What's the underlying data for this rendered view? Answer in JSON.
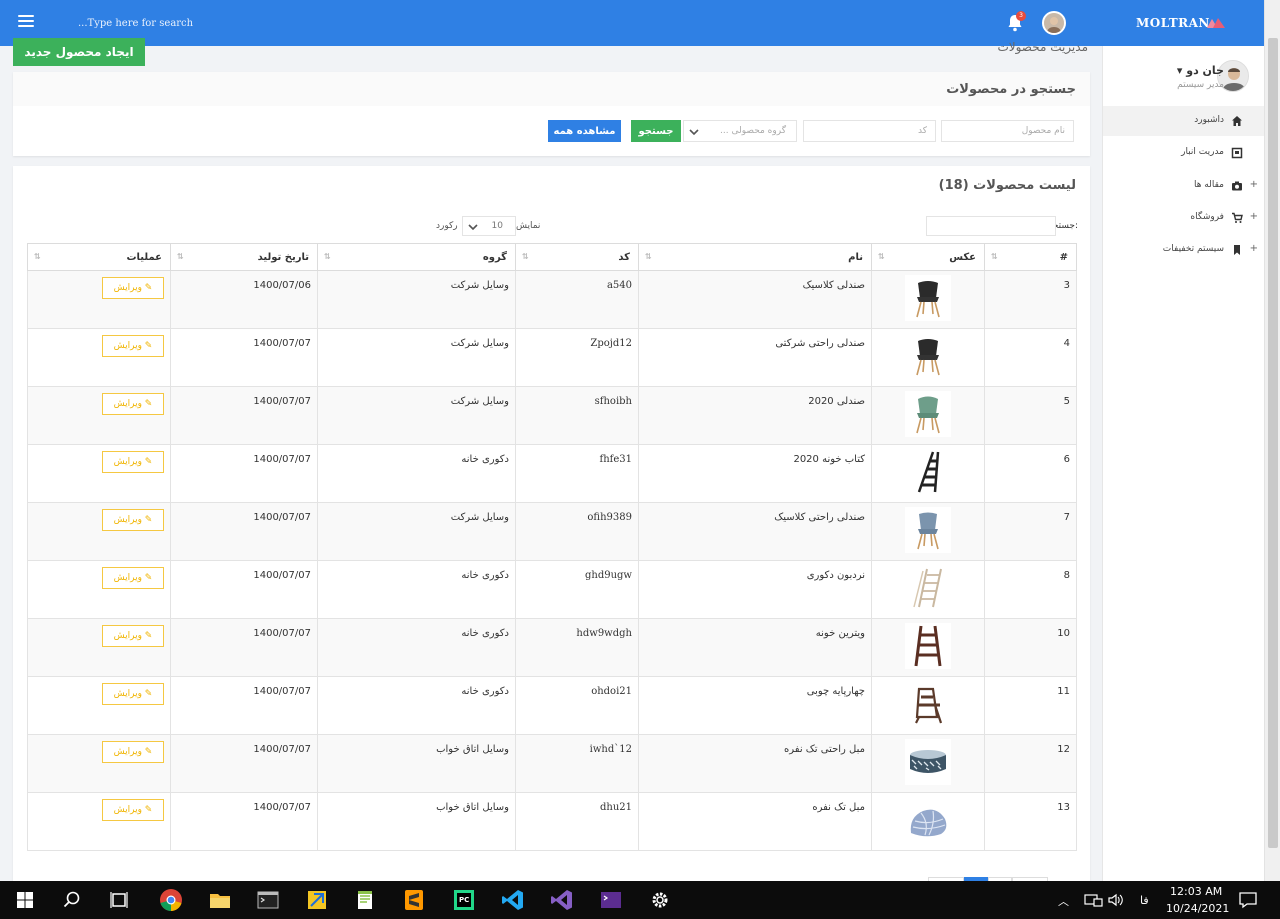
{
  "topbar": {
    "search_placeholder": "...Type here for search",
    "notification_count": "3",
    "brand": "MOLTRAN",
    "brand_color": "#2f80e4"
  },
  "sidebar": {
    "user_name": "جان دو ▾",
    "user_role": "مدیر سیستم",
    "items": [
      {
        "label": "داشبورد",
        "icon": "home-icon",
        "active": true,
        "expandable": false
      },
      {
        "label": "مدریت انبار",
        "icon": "warehouse-icon",
        "active": false,
        "expandable": false
      },
      {
        "label": "مقاله ها",
        "icon": "camera-icon",
        "active": false,
        "expandable": true
      },
      {
        "label": "فروشگاه",
        "icon": "cart-icon",
        "active": false,
        "expandable": true
      },
      {
        "label": "سیستم تخفیفات",
        "icon": "bookmark-icon",
        "active": false,
        "expandable": true
      }
    ]
  },
  "main": {
    "create_button": "ایجاد محصول جدید",
    "page_title": "مدیریت محصولات"
  },
  "search_panel": {
    "title": "جستجو در محصولات",
    "name_placeholder": "نام محصول",
    "code_placeholder": "کد",
    "group_placeholder": "گروه محصولی ...",
    "search_button": "جستجو",
    "show_all_button": "مشاهده همه",
    "search_button_color": "#3cb15b",
    "show_all_button_color": "#2f80e4"
  },
  "list": {
    "title": "لیست محصولات (18)",
    "search_label": "جستجو:",
    "length_prefix": "نمایش",
    "length_value": "10",
    "length_suffix": "رکورد",
    "columns": [
      "#",
      "عکس",
      "نام",
      "کد",
      "گروه",
      "تاریخ تولید",
      "عملیات"
    ],
    "edit_label": "✎ ویرایش",
    "rows": [
      {
        "id": "3",
        "name": "صندلی کلاسیک",
        "code": "a540",
        "group": "وسایل شرکت",
        "date": "1400/07/06",
        "image": "chair-dark-icon"
      },
      {
        "id": "4",
        "name": "صندلی راحتی شرکتی",
        "code": "Zpojd12",
        "group": "وسایل شرکت",
        "date": "1400/07/07",
        "image": "chair-dark-icon"
      },
      {
        "id": "5",
        "name": "صندلی 2020",
        "code": "sfhoibh",
        "group": "وسایل شرکت",
        "date": "1400/07/07",
        "image": "chair-green-icon"
      },
      {
        "id": "6",
        "name": "کتاب خونه 2020",
        "code": "fhfe31",
        "group": "دکوری خانه",
        "date": "1400/07/07",
        "image": "shelf-icon"
      },
      {
        "id": "7",
        "name": "صندلی راحتی کلاسیک",
        "code": "ofih9389",
        "group": "وسایل شرکت",
        "date": "1400/07/07",
        "image": "chair-blue-icon"
      },
      {
        "id": "8",
        "name": "نردبون دکوری",
        "code": "ghd9ugw",
        "group": "دکوری خانه",
        "date": "1400/07/07",
        "image": "ladder-icon"
      },
      {
        "id": "10",
        "name": "ویترین خونه",
        "code": "hdw9wdgh",
        "group": "دکوری خانه",
        "date": "1400/07/07",
        "image": "cabinet-icon"
      },
      {
        "id": "11",
        "name": "چهارپایه چوبی",
        "code": "ohdoi21",
        "group": "دکوری خانه",
        "date": "1400/07/07",
        "image": "stool-icon"
      },
      {
        "id": "12",
        "name": "مبل راحتی تک نفره",
        "code": "iwhd`12",
        "group": "وسایل اتاق خواب",
        "date": "1400/07/07",
        "image": "pouf-icon"
      },
      {
        "id": "13",
        "name": "مبل تک نفره",
        "code": "dhu21",
        "group": "وسایل اتاق خواب",
        "date": "1400/07/07",
        "image": "beanbag-icon"
      }
    ]
  },
  "taskbar": {
    "time": "12:03 AM",
    "date": "10/24/2021",
    "lang": "فا"
  }
}
